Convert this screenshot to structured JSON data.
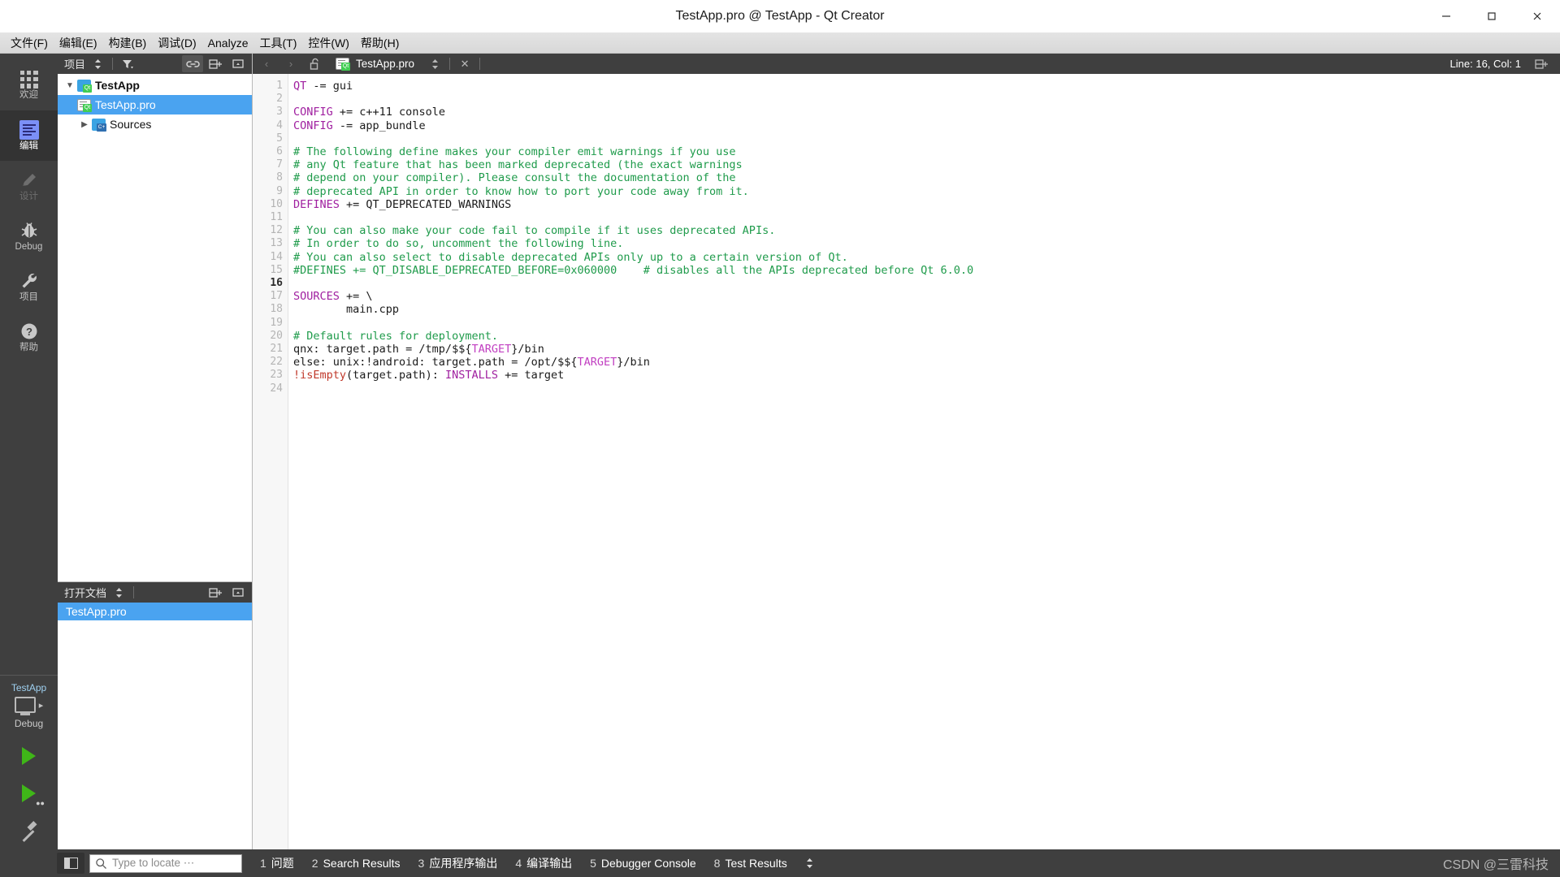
{
  "window": {
    "title": "TestApp.pro @ TestApp - Qt Creator",
    "minimize_label": "—",
    "maximize_label": "❐",
    "close_label": "✕"
  },
  "menubar": {
    "items": [
      {
        "label": "文件(F)"
      },
      {
        "label": "编辑(E)"
      },
      {
        "label": "构建(B)"
      },
      {
        "label": "调试(D)"
      },
      {
        "label": "Analyze"
      },
      {
        "label": "工具(T)"
      },
      {
        "label": "控件(W)"
      },
      {
        "label": "帮助(H)"
      }
    ]
  },
  "modebar": {
    "modes": [
      {
        "label": "欢迎",
        "icon": "grid-icon",
        "state": "normal"
      },
      {
        "label": "编辑",
        "icon": "edit-icon",
        "state": "active"
      },
      {
        "label": "设计",
        "icon": "pencil-icon",
        "state": "disabled"
      },
      {
        "label": "Debug",
        "icon": "bug-icon",
        "state": "normal"
      },
      {
        "label": "项目",
        "icon": "wrench-icon",
        "state": "normal"
      },
      {
        "label": "帮助",
        "icon": "question-icon",
        "state": "normal"
      }
    ],
    "kit": {
      "project_name": "TestApp",
      "build_config": "Debug"
    },
    "run_label": "Run",
    "debug_label": "Start Debugging",
    "build_label": "Build"
  },
  "project_panel": {
    "title": "项目",
    "filter_tooltip": "Filter Tree",
    "sync_tooltip": "Synchronize with Editor",
    "split_tooltip": "Split",
    "close_tooltip": "Close",
    "tree": [
      {
        "label": "TestApp",
        "icon": "qt-project-folder-icon",
        "level": 0,
        "expanded": true,
        "bold": true,
        "selected": false
      },
      {
        "label": "TestApp.pro",
        "icon": "qt-pro-file-icon",
        "level": 1,
        "expanded": null,
        "bold": false,
        "selected": true
      },
      {
        "label": "Sources",
        "icon": "cpp-folder-icon",
        "level": 1,
        "expanded": false,
        "bold": false,
        "selected": false
      }
    ]
  },
  "open_documents": {
    "title": "打开文档",
    "items": [
      {
        "label": "TestApp.pro",
        "selected": true
      }
    ]
  },
  "editor": {
    "back_label": "‹",
    "forward_label": "›",
    "lock_tooltip": "Make Writable",
    "filename": "TestApp.pro",
    "close_label": "✕",
    "line_col": "Line: 16, Col: 1",
    "current_line": 16,
    "total_lines": 24,
    "lines": [
      {
        "n": 1,
        "tokens": [
          {
            "t": "kw",
            "v": "QT"
          },
          {
            "t": "",
            "v": " -= gui"
          }
        ]
      },
      {
        "n": 2,
        "tokens": []
      },
      {
        "n": 3,
        "tokens": [
          {
            "t": "kw",
            "v": "CONFIG"
          },
          {
            "t": "",
            "v": " += c++11 console"
          }
        ]
      },
      {
        "n": 4,
        "tokens": [
          {
            "t": "kw",
            "v": "CONFIG"
          },
          {
            "t": "",
            "v": " -= app_bundle"
          }
        ]
      },
      {
        "n": 5,
        "tokens": []
      },
      {
        "n": 6,
        "tokens": [
          {
            "t": "cm",
            "v": "# The following define makes your compiler emit warnings if you use"
          }
        ]
      },
      {
        "n": 7,
        "tokens": [
          {
            "t": "cm",
            "v": "# any Qt feature that has been marked deprecated (the exact warnings"
          }
        ]
      },
      {
        "n": 8,
        "tokens": [
          {
            "t": "cm",
            "v": "# depend on your compiler). Please consult the documentation of the"
          }
        ]
      },
      {
        "n": 9,
        "tokens": [
          {
            "t": "cm",
            "v": "# deprecated API in order to know how to port your code away from it."
          }
        ]
      },
      {
        "n": 10,
        "tokens": [
          {
            "t": "kw",
            "v": "DEFINES"
          },
          {
            "t": "",
            "v": " += QT_DEPRECATED_WARNINGS"
          }
        ]
      },
      {
        "n": 11,
        "tokens": []
      },
      {
        "n": 12,
        "tokens": [
          {
            "t": "cm",
            "v": "# You can also make your code fail to compile if it uses deprecated APIs."
          }
        ]
      },
      {
        "n": 13,
        "tokens": [
          {
            "t": "cm",
            "v": "# In order to do so, uncomment the following line."
          }
        ]
      },
      {
        "n": 14,
        "tokens": [
          {
            "t": "cm",
            "v": "# You can also select to disable deprecated APIs only up to a certain version of Qt."
          }
        ]
      },
      {
        "n": 15,
        "tokens": [
          {
            "t": "cm",
            "v": "#DEFINES += QT_DISABLE_DEPRECATED_BEFORE=0x060000    # disables all the APIs deprecated before Qt 6.0.0"
          }
        ]
      },
      {
        "n": 16,
        "tokens": []
      },
      {
        "n": 17,
        "tokens": [
          {
            "t": "kw",
            "v": "SOURCES"
          },
          {
            "t": "",
            "v": " += \\"
          }
        ]
      },
      {
        "n": 18,
        "tokens": [
          {
            "t": "",
            "v": "        main.cpp"
          }
        ]
      },
      {
        "n": 19,
        "tokens": []
      },
      {
        "n": 20,
        "tokens": [
          {
            "t": "cm",
            "v": "# Default rules for deployment."
          }
        ]
      },
      {
        "n": 21,
        "tokens": [
          {
            "t": "",
            "v": "qnx: target.path = /tmp/$${"
          },
          {
            "t": "var",
            "v": "TARGET"
          },
          {
            "t": "",
            "v": "}/bin"
          }
        ]
      },
      {
        "n": 22,
        "tokens": [
          {
            "t": "",
            "v": "else: unix:!android: target.path = /opt/$${"
          },
          {
            "t": "var",
            "v": "TARGET"
          },
          {
            "t": "",
            "v": "}/bin"
          }
        ]
      },
      {
        "n": 23,
        "tokens": [
          {
            "t": "fn",
            "v": "!isEmpty"
          },
          {
            "t": "",
            "v": "(target.path): "
          },
          {
            "t": "kw",
            "v": "INSTALLS"
          },
          {
            "t": "",
            "v": " += target"
          }
        ]
      },
      {
        "n": 24,
        "tokens": []
      }
    ]
  },
  "statusbar": {
    "sidebar_toggle_tooltip": "Hide Sidebar",
    "locator_placeholder": "Type to locate ⋯",
    "panes": [
      {
        "num": "1",
        "label": "问题"
      },
      {
        "num": "2",
        "label": "Search Results"
      },
      {
        "num": "3",
        "label": "应用程序输出"
      },
      {
        "num": "4",
        "label": "编译输出"
      },
      {
        "num": "5",
        "label": "Debugger Console"
      },
      {
        "num": "8",
        "label": "Test Results"
      }
    ],
    "watermark": "CSDN @三雷科技"
  },
  "colors": {
    "accent": "#4aa3f0",
    "dark_chrome": "#3f3f3f",
    "keyword": "#a020a0",
    "comment": "#1f9b4b",
    "function": "#c0392b",
    "variable": "#c13fc1"
  }
}
